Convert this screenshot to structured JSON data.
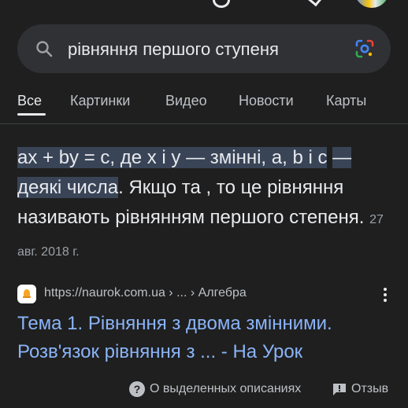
{
  "search": {
    "query": "рівняння першого ступеня"
  },
  "tabs": [
    {
      "label": "Все"
    },
    {
      "label": "Картинки"
    },
    {
      "label": "Видео"
    },
    {
      "label": "Новости"
    },
    {
      "label": "Карты"
    }
  ],
  "snippet": {
    "highlight_1": "ax + by = c, де x і y — змінні, a, b і c",
    "highlight_2": "— деякі числа",
    "rest": ". Якщо та , то це рівняння називають рівнянням першого степеня.",
    "date": "27 авг. 2018 г."
  },
  "result": {
    "url": "https://naurok.com.ua",
    "breadcrumb": " › ... › Алгебра",
    "title": "Тема 1. Рівняння з двома змінними. Розв'язок рівняння з ... - На Урок"
  },
  "footer": {
    "about": "О выделенных описаниях",
    "feedback": "Отзыв"
  },
  "colors": {
    "background": "#1f1f1f",
    "link": "#8ab4f8",
    "highlight": "#394457"
  }
}
